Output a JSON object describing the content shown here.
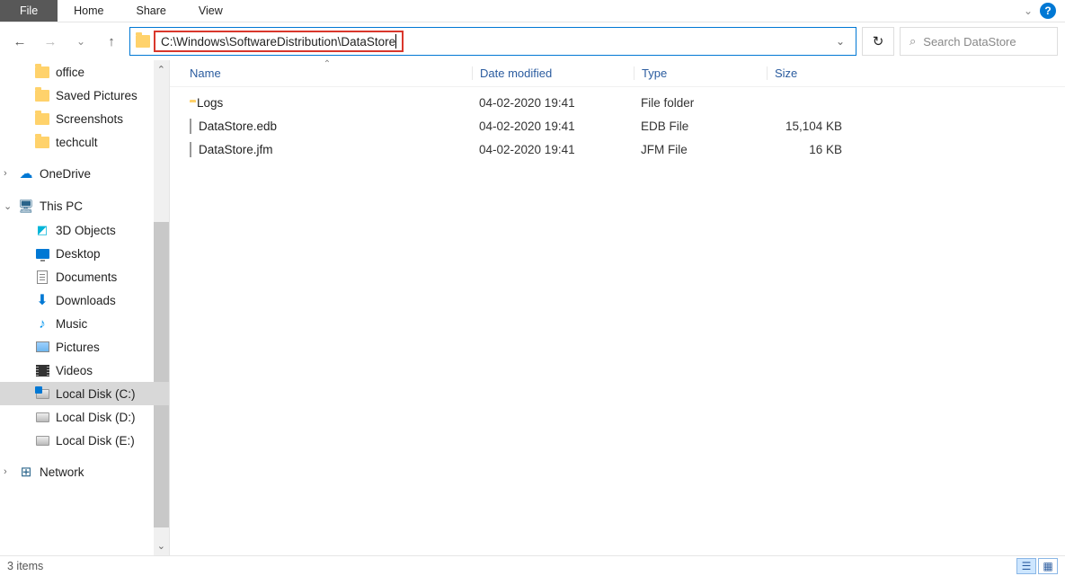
{
  "ribbon": {
    "tabs": {
      "file": "File",
      "home": "Home",
      "share": "Share",
      "view": "View"
    }
  },
  "address": {
    "path": "C:\\Windows\\SoftwareDistribution\\DataStore"
  },
  "search": {
    "placeholder": "Search DataStore"
  },
  "sidebar": {
    "quick": [
      "office",
      "Saved Pictures",
      "Screenshots",
      "techcult"
    ],
    "onedrive": "OneDrive",
    "thispc": "This PC",
    "pcitems": [
      "3D Objects",
      "Desktop",
      "Documents",
      "Downloads",
      "Music",
      "Pictures",
      "Videos",
      "Local Disk (C:)",
      "Local Disk (D:)",
      "Local Disk (E:)"
    ],
    "network": "Network"
  },
  "columns": {
    "name": "Name",
    "date": "Date modified",
    "type": "Type",
    "size": "Size"
  },
  "files": [
    {
      "name": "Logs",
      "date": "04-02-2020 19:41",
      "type": "File folder",
      "size": "",
      "icon": "folder"
    },
    {
      "name": "DataStore.edb",
      "date": "04-02-2020 19:41",
      "type": "EDB File",
      "size": "15,104 KB",
      "icon": "file"
    },
    {
      "name": "DataStore.jfm",
      "date": "04-02-2020 19:41",
      "type": "JFM File",
      "size": "16 KB",
      "icon": "file"
    }
  ],
  "status": {
    "count": "3 items"
  }
}
